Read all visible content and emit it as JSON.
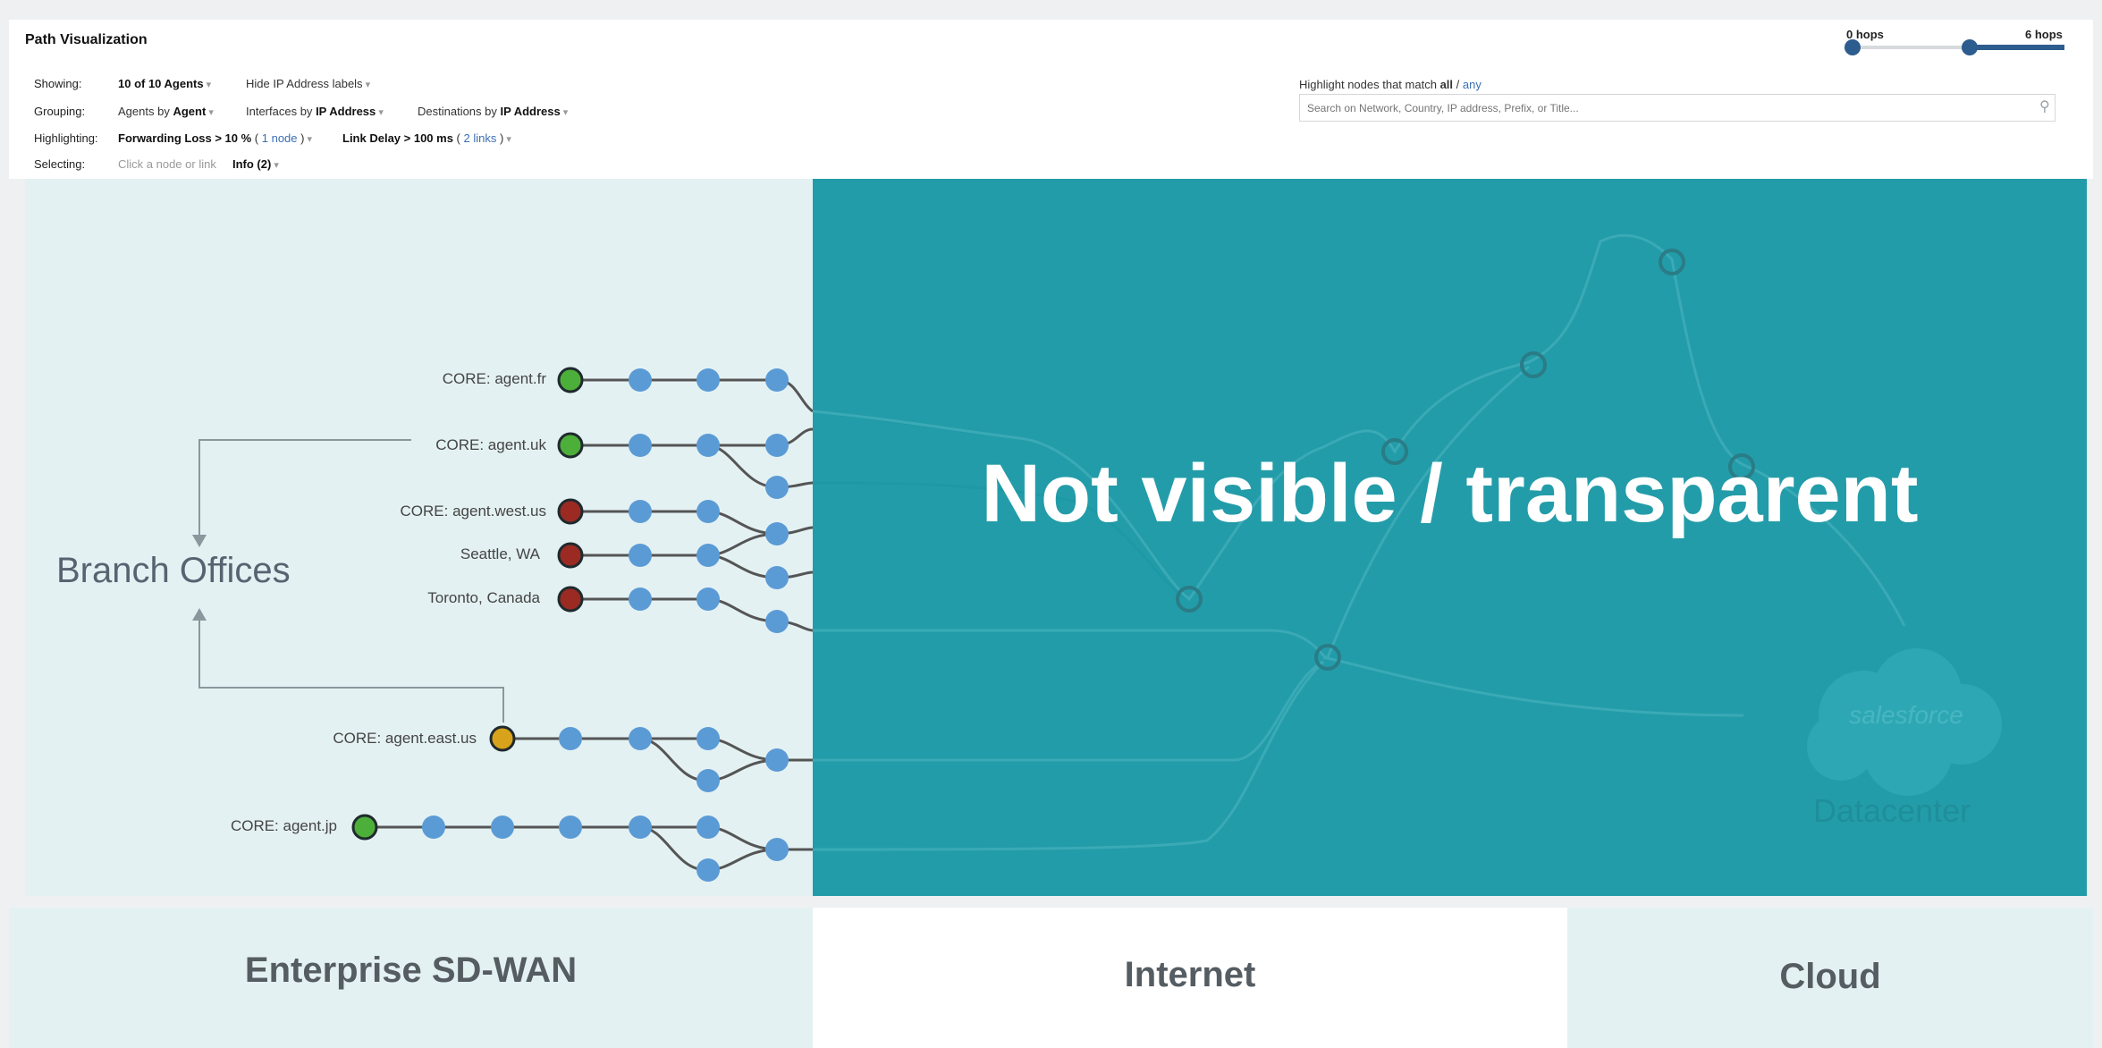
{
  "panel": {
    "title": "Path Visualization",
    "showing": {
      "label": "Showing:",
      "agents_value": "10 of 10 Agents",
      "hide_labels": "Hide IP Address labels"
    },
    "grouping": {
      "label": "Grouping:",
      "agents_prefix": "Agents by",
      "agents_value": "Agent",
      "interfaces_prefix": "Interfaces by",
      "interfaces_value": "IP Address",
      "destinations_prefix": "Destinations by",
      "destinations_value": "IP Address"
    },
    "highlighting": {
      "label": "Highlighting:",
      "loss_value": "Forwarding Loss > 10 %",
      "loss_count": "1 node",
      "delay_value": "Link Delay > 100 ms",
      "delay_count": "2 links"
    },
    "selecting": {
      "label": "Selecting:",
      "hint": "Click a node or link",
      "info": "Info (2)"
    },
    "highlight_match": {
      "prefix": "Highlight nodes that match",
      "all": "all",
      "separator": "/",
      "any": "any"
    },
    "search": {
      "placeholder": "Search on Network, Country, IP address, Prefix, or Title..."
    },
    "hops": {
      "min_label": "0 hops",
      "max_label": "6 hops"
    }
  },
  "diagram": {
    "branch_label": "Branch Offices",
    "overlay_text": "Not visible / transparent",
    "datacenter_label": "Datacenter",
    "salesforce_label": "salesforce",
    "agents": [
      {
        "label": "CORE: agent.fr",
        "status": "green"
      },
      {
        "label": "CORE: agent.uk",
        "status": "green"
      },
      {
        "label": "CORE: agent.west.us",
        "status": "red"
      },
      {
        "label": "Seattle, WA",
        "status": "red"
      },
      {
        "label": "Toronto, Canada",
        "status": "red"
      },
      {
        "label": "CORE: agent.east.us",
        "status": "yellow"
      },
      {
        "label": "CORE: agent.jp",
        "status": "green"
      }
    ],
    "colors": {
      "node": "#5b9bd5",
      "green": "#4caf3a",
      "red": "#9b2a22",
      "yellow": "#d9a21b",
      "overlay": "#1c99a6"
    }
  },
  "zones": {
    "sdwan": "Enterprise SD-WAN",
    "internet": "Internet",
    "cloud": "Cloud"
  }
}
